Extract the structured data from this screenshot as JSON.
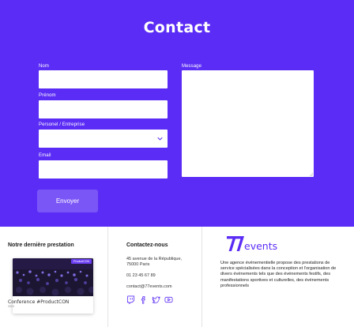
{
  "page": {
    "title": "Contact"
  },
  "colors": {
    "brand": "#5b2cf5",
    "button": "#7b56f7",
    "white": "#ffffff"
  },
  "form": {
    "nom_label": "Nom",
    "prenom_label": "Prénom",
    "type_label": "Personel / Entreprise",
    "email_label": "Email",
    "message_label": "Message",
    "submit_label": "Envoyer",
    "type_selected": ""
  },
  "footer": {
    "latest": {
      "heading": "Notre dernière prestation",
      "badge": "ProductCON",
      "event_title": "Conference #ProductCON",
      "event_date": "2023"
    },
    "contact": {
      "heading": "Contactez-nous",
      "address_line1": "45 avenue de la République,",
      "address_line2": "75000 Paris",
      "phone": "01 23 45 67 89",
      "email": "contact@77events.com",
      "social_icons": [
        "twitch-icon",
        "facebook-icon",
        "twitter-icon",
        "youtube-icon"
      ]
    },
    "about": {
      "logo_text": "77events",
      "description": "Une agence événementielle propose des prestations de service spécialisées dans la conception et l'organisation de divers événements tels que des événements festifs, des manifestations sportives et culturelles, des événements professionnels"
    }
  }
}
